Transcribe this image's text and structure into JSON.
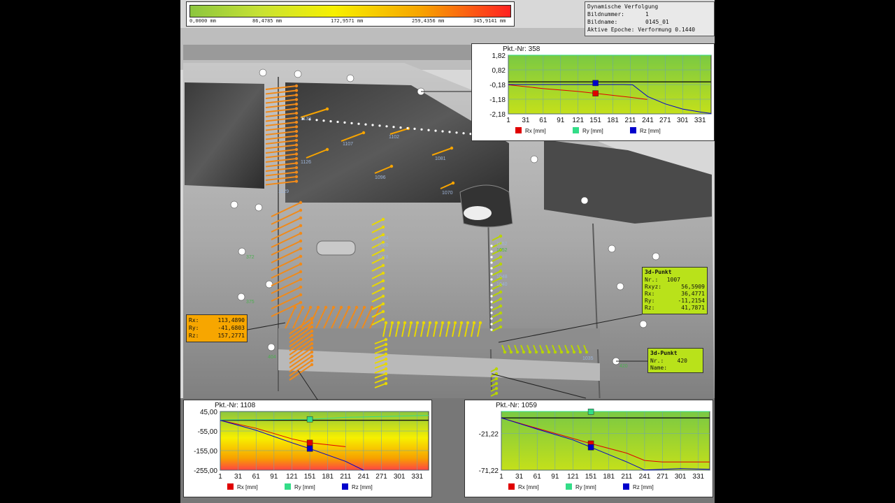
{
  "scale_bar": {
    "ticks": [
      "0,0000 mm",
      "86,4785 mm",
      "172,9571 mm",
      "259,4356 mm",
      "345,9141 mm"
    ],
    "colors": [
      "#8cc63f",
      "#f7f000",
      "#f22"
    ]
  },
  "info_panel": {
    "title": "Dynamische Verfolgung",
    "rows": [
      {
        "label": "Bildnummer:",
        "value": "1"
      },
      {
        "label": "Bildname:",
        "value": "0145_01"
      },
      {
        "label": "Aktive Epoche: Verformung 0.1440",
        "value": ""
      }
    ]
  },
  "point_labels": {
    "orange_arrows": [
      "1133",
      "1126",
      "1129"
    ],
    "yellow_arrows": [
      "1107",
      "1102",
      "1081",
      "1096",
      "1070"
    ],
    "green_markers": [
      "372",
      "375",
      "404",
      "420",
      "1052"
    ],
    "blue_labels": [
      "1084",
      "1080",
      "1078",
      "1048",
      "1040",
      "1035",
      "1052"
    ]
  },
  "popup_rx": {
    "rows": [
      {
        "label": "Rx:",
        "value": "113,4890"
      },
      {
        "label": "Ry:",
        "value": "-41,6803"
      },
      {
        "label": "Rz:",
        "value": "157,2771"
      }
    ]
  },
  "popup_1007": {
    "title": "3d-Punkt",
    "rows": [
      {
        "label": "Nr.:",
        "value": "1007"
      },
      {
        "label": "Rxyz:",
        "value": "56,5909"
      },
      {
        "label": "Rx:",
        "value": "36,4771"
      },
      {
        "label": "Ry:",
        "value": "-11,2154"
      },
      {
        "label": "Rz:",
        "value": "41,7871"
      }
    ]
  },
  "popup_420": {
    "title": "3d-Punkt",
    "rows": [
      {
        "label": "Nr.:",
        "value": "420"
      },
      {
        "label": "Name:",
        "value": ""
      }
    ]
  },
  "chart_data": [
    {
      "type": "line",
      "title": "Pkt.-Nr:  358",
      "x_ticks": [
        "1",
        "31",
        "61",
        "91",
        "121",
        "151",
        "181",
        "211",
        "241",
        "271",
        "301",
        "331"
      ],
      "y_ticks": [
        "1,82",
        "0,82",
        "-0,18",
        "-1,18",
        "-2,18"
      ],
      "ylim": [
        -2.18,
        1.82
      ],
      "xlim": [
        1,
        350
      ],
      "background": "green",
      "series": [
        {
          "name": "Rx [mm]",
          "color": "#e00000",
          "points": [
            [
              1,
              -0.2
            ],
            [
              60,
              -0.45
            ],
            [
              121,
              -0.65
            ],
            [
              151,
              -0.78
            ],
            [
              211,
              -1.05
            ],
            [
              240,
              -1.2
            ]
          ],
          "marker": [
            151,
            -0.78
          ]
        },
        {
          "name": "Ry [mm]",
          "color": "#33dd88",
          "points": [
            [
              1,
              1.82
            ],
            [
              350,
              1.82
            ]
          ],
          "marker": null
        },
        {
          "name": "Rz [mm]",
          "color": "#0000cc",
          "points": [
            [
              1,
              -0.18
            ],
            [
              200,
              -0.18
            ],
            [
              215,
              -0.2
            ],
            [
              241,
              -1.0
            ],
            [
              271,
              -1.5
            ],
            [
              301,
              -1.85
            ],
            [
              331,
              -2.05
            ],
            [
              350,
              -2.15
            ]
          ],
          "marker": [
            151,
            -0.08
          ]
        }
      ]
    },
    {
      "type": "line",
      "title": "Pkt.-Nr:  1108",
      "x_ticks": [
        "1",
        "31",
        "61",
        "91",
        "121",
        "151",
        "181",
        "211",
        "241",
        "271",
        "301",
        "331"
      ],
      "y_ticks": [
        "45,00",
        "-55,00",
        "-155,00",
        "-255,00"
      ],
      "ylim": [
        -255,
        45
      ],
      "xlim": [
        1,
        350
      ],
      "background": "heat",
      "series": [
        {
          "name": "Rx [mm]",
          "color": "#e00000",
          "points": [
            [
              1,
              0
            ],
            [
              60,
              -40
            ],
            [
              121,
              -95
            ],
            [
              151,
              -115
            ],
            [
              211,
              -135
            ]
          ],
          "marker": [
            151,
            -115
          ]
        },
        {
          "name": "Ry [mm]",
          "color": "#33dd88",
          "points": [
            [
              1,
              2
            ],
            [
              151,
              5
            ],
            [
              211,
              15
            ],
            [
              350,
              25
            ]
          ],
          "marker": [
            151,
            5
          ]
        },
        {
          "name": "Rz [mm]",
          "color": "#0000cc",
          "points": [
            [
              1,
              0
            ],
            [
              60,
              -50
            ],
            [
              121,
              -115
            ],
            [
              151,
              -145
            ],
            [
              211,
              -210
            ],
            [
              241,
              -255
            ]
          ],
          "marker": [
            151,
            -145
          ]
        }
      ]
    },
    {
      "type": "line",
      "title": "Pkt.-Nr:  1059",
      "x_ticks": [
        "1",
        "31",
        "61",
        "91",
        "121",
        "151",
        "181",
        "211",
        "241",
        "271",
        "301",
        "331"
      ],
      "y_ticks": [
        "-21,22",
        "-71,22"
      ],
      "ylim": [
        -71.22,
        8.78
      ],
      "xlim": [
        1,
        350
      ],
      "background": "green",
      "series": [
        {
          "name": "Rx [mm]",
          "color": "#e00000",
          "points": [
            [
              1,
              0
            ],
            [
              60,
              -14
            ],
            [
              121,
              -28
            ],
            [
              151,
              -35
            ],
            [
              211,
              -48
            ],
            [
              241,
              -58
            ],
            [
              271,
              -60
            ],
            [
              301,
              -60
            ],
            [
              350,
              -60
            ]
          ],
          "marker": [
            151,
            -35
          ]
        },
        {
          "name": "Ry [mm]",
          "color": "#33dd88",
          "points": [
            [
              1,
              8.78
            ],
            [
              350,
              8.78
            ]
          ],
          "marker": [
            151,
            8.5
          ]
        },
        {
          "name": "Rz [mm]",
          "color": "#0000cc",
          "points": [
            [
              1,
              0
            ],
            [
              60,
              -15
            ],
            [
              121,
              -30
            ],
            [
              151,
              -40
            ],
            [
              211,
              -60
            ],
            [
              241,
              -71
            ],
            [
              271,
              -70
            ],
            [
              301,
              -69
            ],
            [
              350,
              -70
            ]
          ],
          "marker": [
            151,
            -40
          ]
        }
      ]
    }
  ]
}
